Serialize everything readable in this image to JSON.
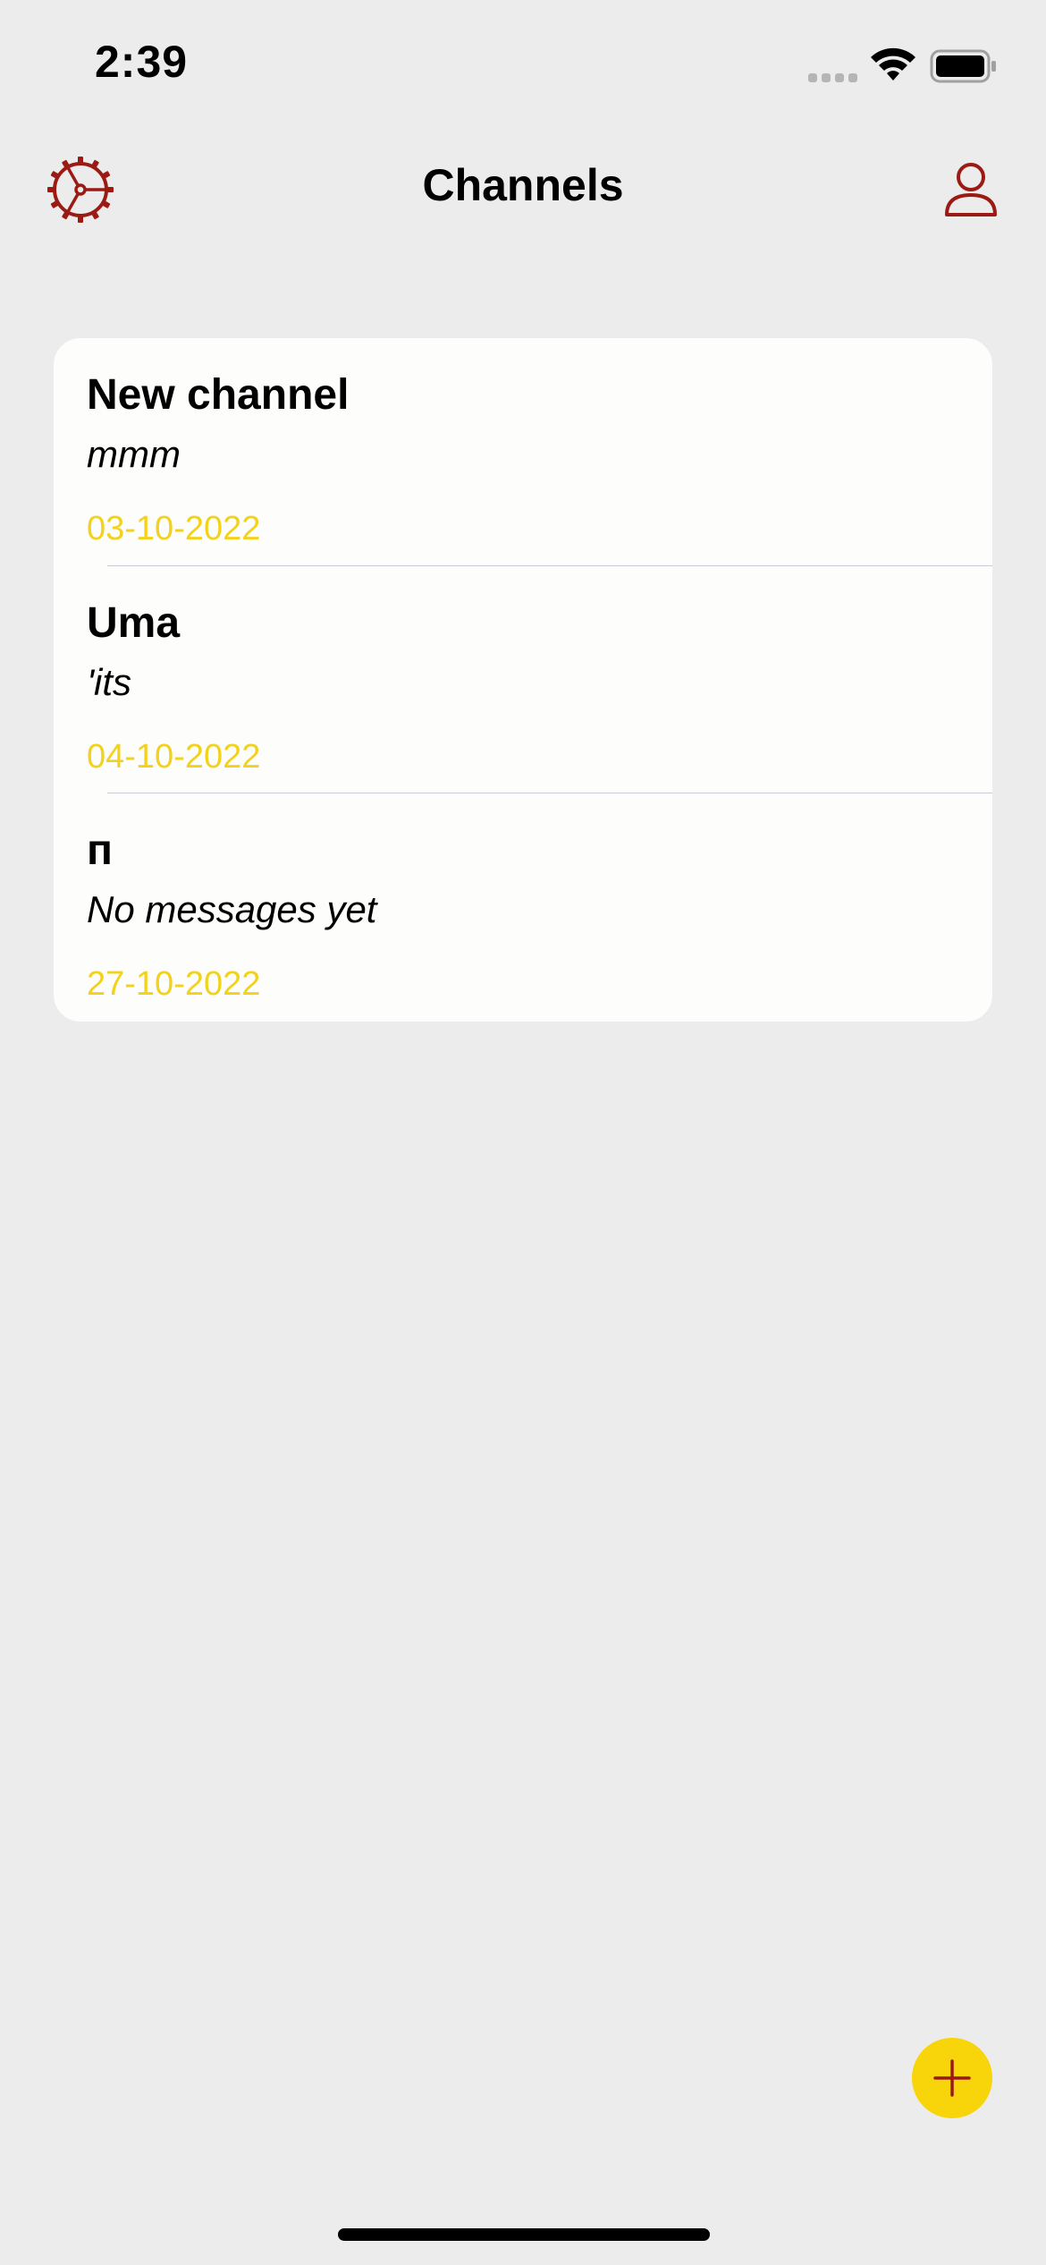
{
  "status_bar": {
    "time": "2:39",
    "signal_icon": "cellular-signal-icon",
    "wifi_icon": "wifi-icon",
    "battery_icon": "battery-icon"
  },
  "nav": {
    "title": "Channels",
    "settings_icon": "gear-icon",
    "profile_icon": "person-icon"
  },
  "channels": [
    {
      "name": "New channel",
      "last_message": "mmm",
      "date": "03-10-2022"
    },
    {
      "name": "Uma",
      "last_message": "'its",
      "date": "04-10-2022"
    },
    {
      "name": "п",
      "last_message": "No messages yet",
      "date": "27-10-2022"
    }
  ],
  "add_button": {
    "icon": "plus-icon"
  },
  "colors": {
    "accent": "#9b1b14",
    "date": "#f2d21c",
    "fab": "#f8d40a",
    "background": "#ececec",
    "card": "#fdfdfb"
  }
}
